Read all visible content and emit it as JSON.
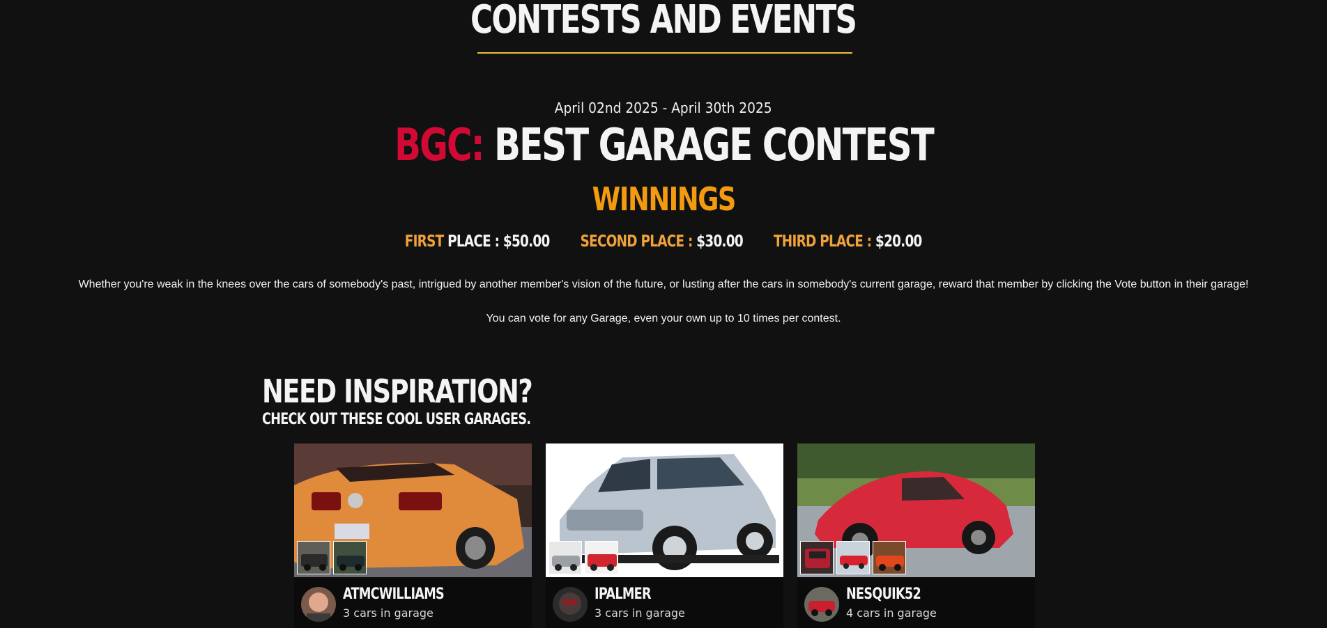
{
  "page": {
    "title": "CONTESTS AND EVENTS"
  },
  "contest": {
    "date_range": "April 02nd 2025 - April 30th 2025",
    "prefix": "BGC:",
    "name": "BEST GARAGE CONTEST",
    "winnings_heading": "WINNINGS",
    "places": [
      {
        "rank": "FIRST",
        "suffix": " PLACE : ",
        "amount": "$50.00"
      },
      {
        "rank": "SECOND PLACE :",
        "suffix": " ",
        "amount": "$30.00"
      },
      {
        "rank": "THIRD PLACE :",
        "suffix": " ",
        "amount": "$20.00"
      }
    ],
    "description": "Whether you're weak in the knees over the cars of somebody's past, intrigued by another member's vision of the future, or lusting after the cars in somebody's current garage, reward that member by clicking the Vote button in their garage!",
    "vote_note": "You can vote for any Garage, even your own up to 10 times per contest."
  },
  "inspiration": {
    "title": "NEED INSPIRATION?",
    "subtitle": "CHECK OUT THESE COOL USER GARAGES.",
    "garages": [
      {
        "username": "ATMCWILLIAMS",
        "cars": "3 cars in garage",
        "main_color": "#e08a3c"
      },
      {
        "username": "IPALMER",
        "cars": "3 cars in garage",
        "main_color": "#b9c4cf"
      },
      {
        "username": "NESQUIK52",
        "cars": "4 cars in garage",
        "main_color": "#d62a3c"
      }
    ]
  },
  "colors": {
    "background": "#111111",
    "accent_red": "#d10a35",
    "accent_orange": "#f39a11",
    "accent_gold": "#f2c12e",
    "place_label": "#f0a23a"
  }
}
